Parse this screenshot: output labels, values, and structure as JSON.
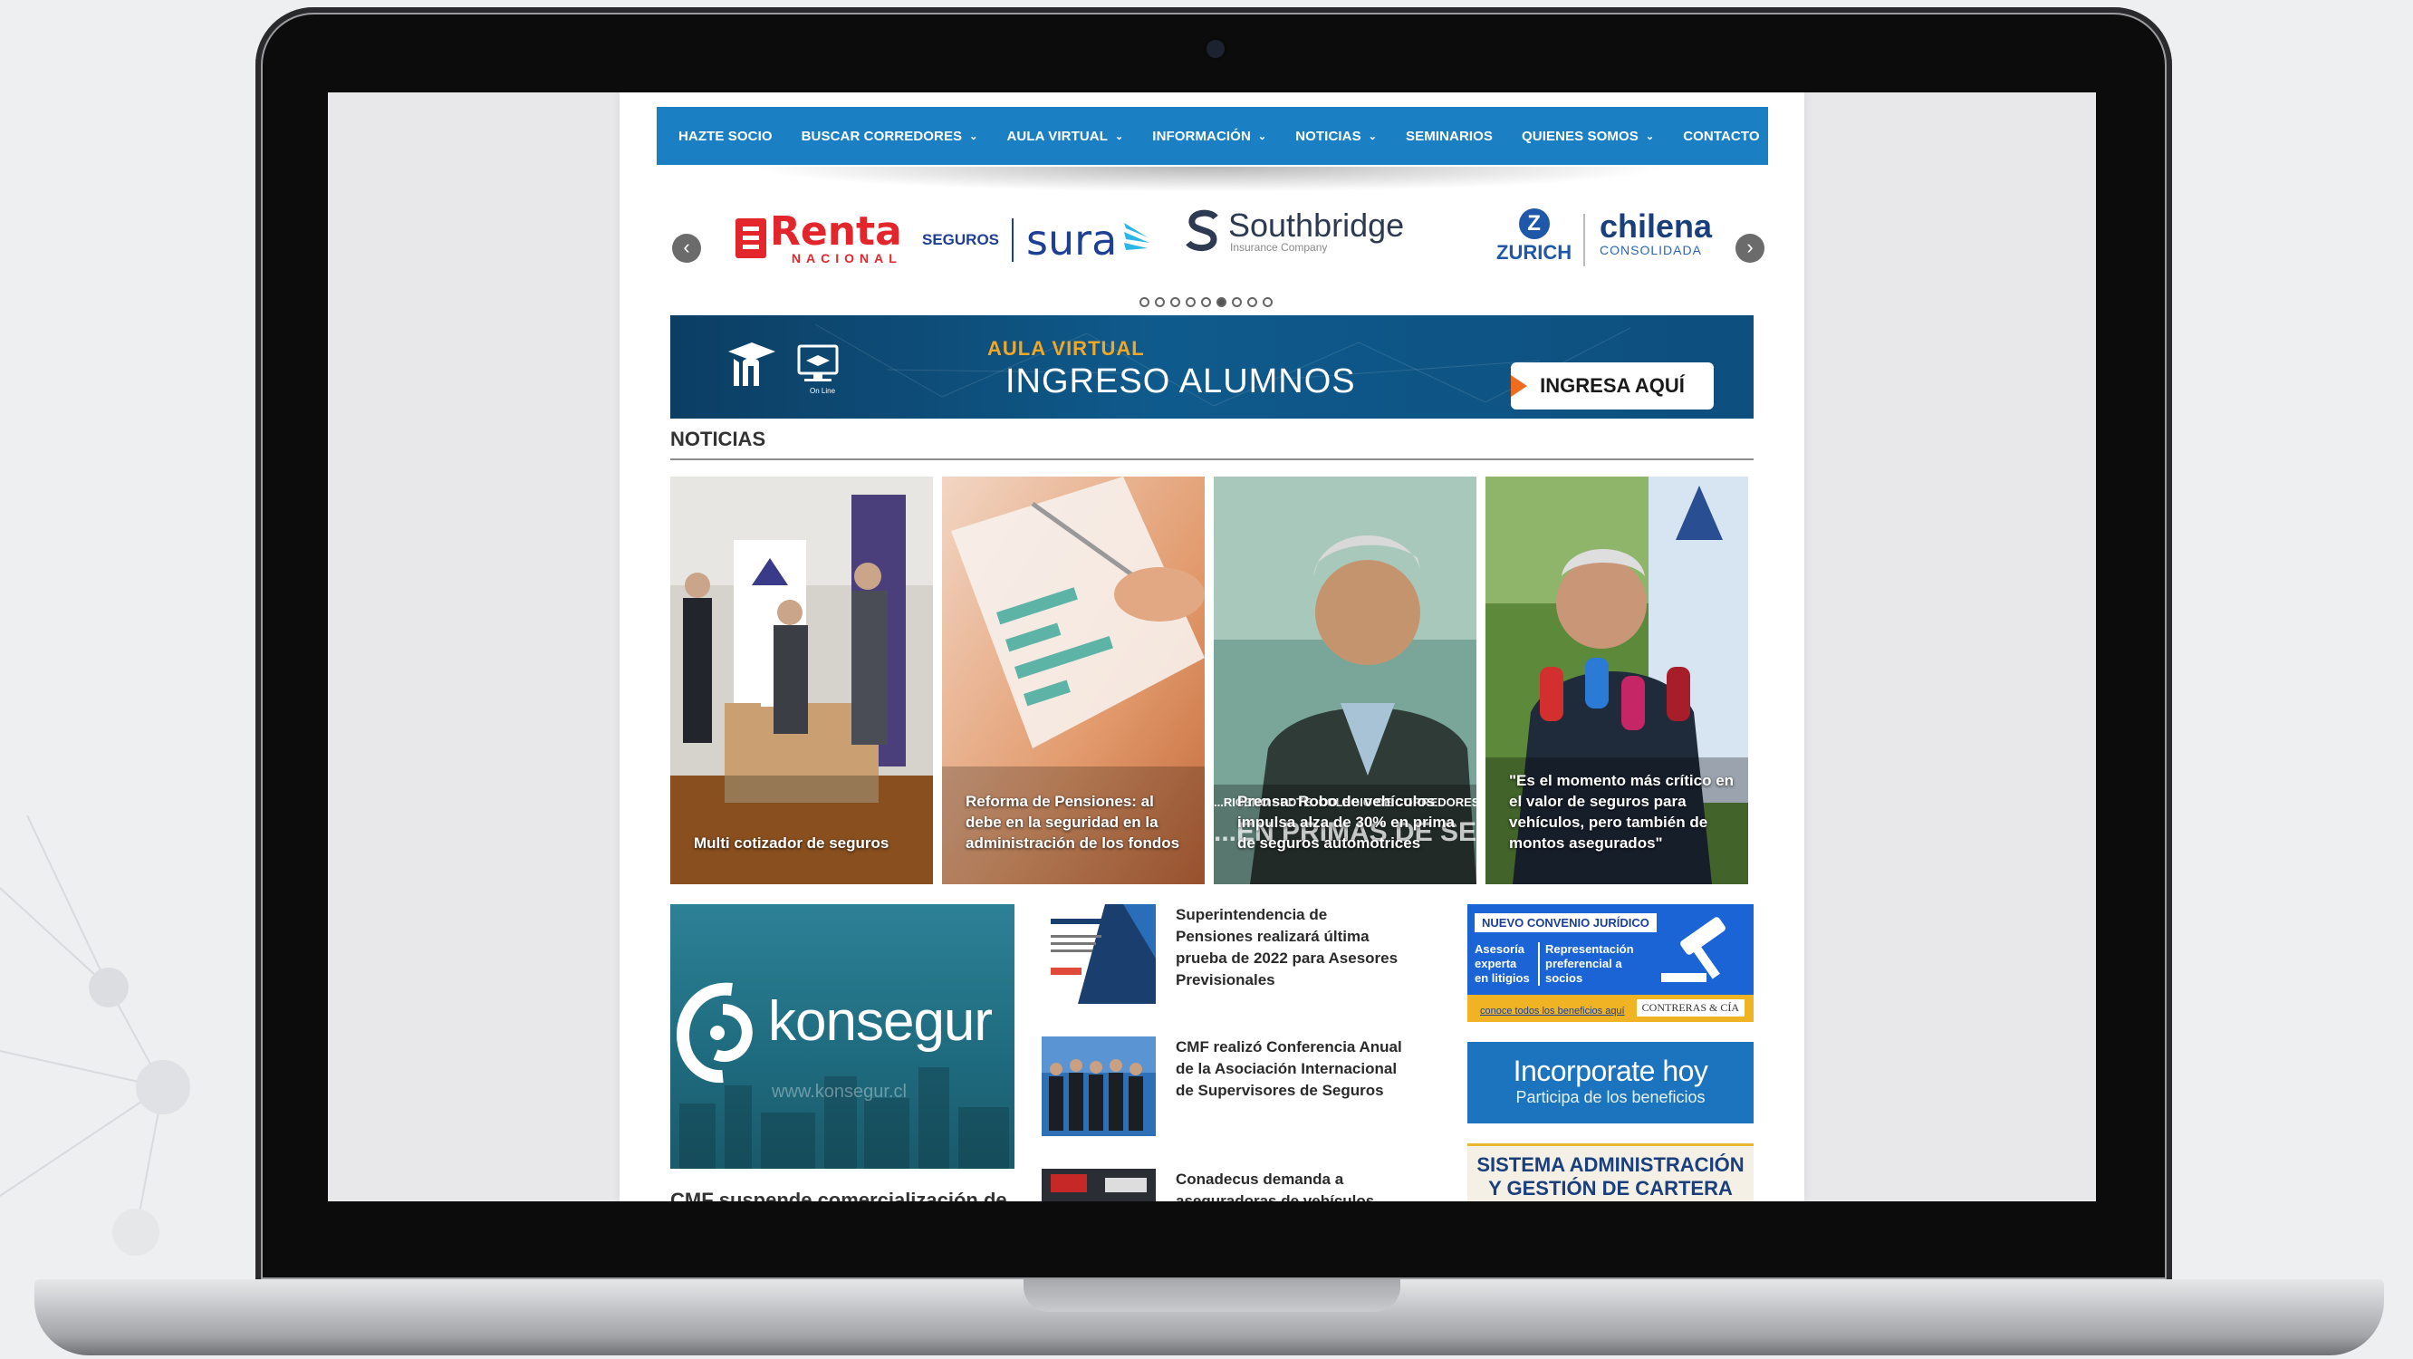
{
  "nav": {
    "items": [
      {
        "label": "HAZTE SOCIO",
        "dropdown": false
      },
      {
        "label": "BUSCAR CORREDORES",
        "dropdown": true
      },
      {
        "label": "AULA VIRTUAL",
        "dropdown": true
      },
      {
        "label": "INFORMACIÓN",
        "dropdown": true
      },
      {
        "label": "NOTICIAS",
        "dropdown": true
      },
      {
        "label": "SEMINARIOS",
        "dropdown": false
      },
      {
        "label": "QUIENES SOMOS",
        "dropdown": true
      },
      {
        "label": "CONTACTO",
        "dropdown": false
      }
    ],
    "dropdown_icon": "chevron-down-icon"
  },
  "sponsors": {
    "logos": [
      {
        "name": "Renta",
        "sub": "NACIONAL",
        "color": "#e3262c"
      },
      {
        "prefix": "SEGUROS",
        "name": "sura",
        "color": "#1d3f94"
      },
      {
        "name": "Southbridge",
        "sub": "Insurance Company",
        "color": "#2d3a52"
      },
      {
        "name": "ZURICH",
        "color": "#1f58a8"
      },
      {
        "name": "chilena",
        "sub": "CONSOLIDADA",
        "color": "#1a3f7c"
      }
    ],
    "dots_count": 9,
    "active_dot": 5,
    "prev_icon": "chevron-left-icon",
    "next_icon": "chevron-right-icon"
  },
  "banner": {
    "icon_label": "On Line",
    "kicker": "AULA VIRTUAL",
    "title": "INGRESO ALUMNOS",
    "cta": "INGRESA AQUÍ"
  },
  "noticias": {
    "title": "NOTICIAS",
    "cards": [
      {
        "caption": "Multi cotizador de seguros"
      },
      {
        "caption": "Reforma de Pensiones: al debe en la seguridad en la administración de los fondos"
      },
      {
        "caption": "Prensa: Robo de vehículos impulsa alza de 30% en prima de seguros automotrices",
        "overlay": "...RICENO • PDTE. COLEGIO DE CORREDORES",
        "overlay2": "...EN PRIMAS DE SEGUROS"
      },
      {
        "caption": "\"Es el momento más crítico en el valor de seguros para vehículos, pero también de montos asegurados\""
      }
    ]
  },
  "konsegur": {
    "name": "konsegur",
    "url": "www.konsegur.cl"
  },
  "cut_title": "CMF suspende comercialización de",
  "news_list": [
    {
      "title": "Superintendencia de Pensiones realizará última prueba de 2022 para Asesores Previsionales"
    },
    {
      "title": "CMF realizó Conferencia Anual de la Asociación Internacional de Supervisores de Seguros"
    },
    {
      "title": "Conadecus demanda a aseguradoras de vehículos por"
    }
  ],
  "ads": {
    "convenio": {
      "tag": "NUEVO CONVENIO JURÍDICO",
      "col1": "Asesoría experta en litigios",
      "col2": "Representación preferencial a socios",
      "link": "conoce todos los beneficios aquí",
      "brand": "CONTRERAS & CÍA"
    },
    "incorporate": {
      "title": "Incorporate hoy",
      "sub": "Participa de los beneficios"
    },
    "sistema": {
      "line1": "SISTEMA ADMINISTRACIÓN",
      "line2": "Y GESTIÓN DE CARTERA"
    }
  },
  "colors": {
    "nav": "#1b7fc3",
    "banner": "#0f5a8c",
    "accent": "#f5a623",
    "cta_arrow": "#ef6b1f"
  }
}
